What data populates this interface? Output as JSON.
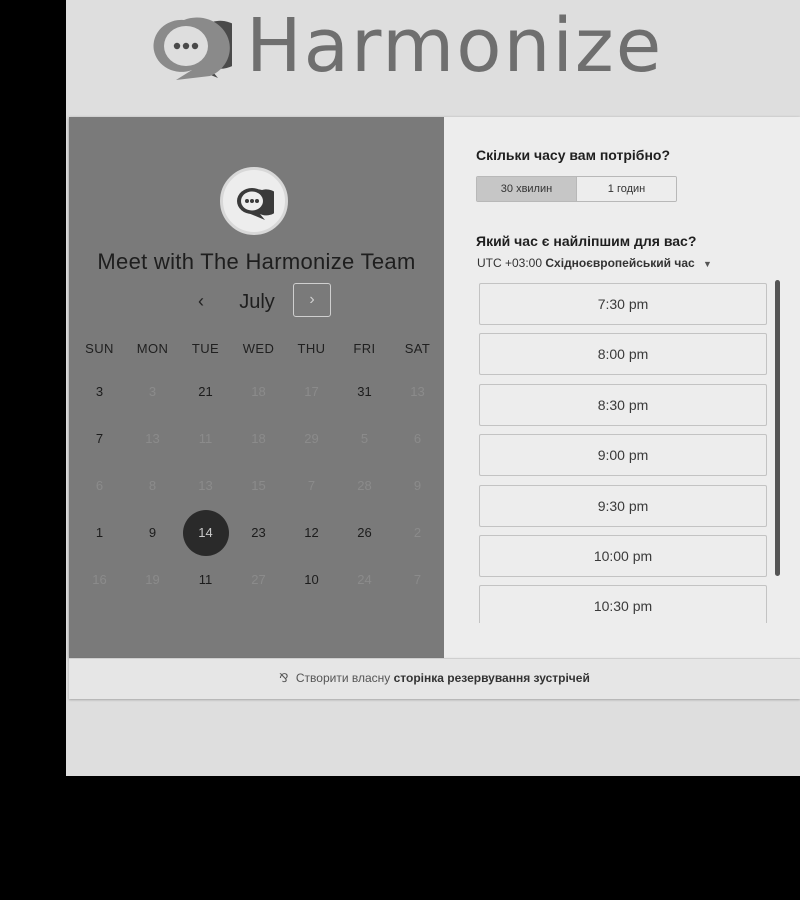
{
  "brand": {
    "name": "Harmonize",
    "logo_icon": "chat-bubbles-icon"
  },
  "calendar": {
    "title": "Meet with The Harmonize Team",
    "avatar_icon": "chat-bubbles-icon",
    "prev_label": "‹",
    "next_label": "›",
    "month": "July",
    "weekdays": [
      "SUN",
      "MON",
      "TUE",
      "WED",
      "THU",
      "FRI",
      "SAT"
    ],
    "weeks": [
      [
        {
          "d": "3",
          "on": true
        },
        {
          "d": "3",
          "on": false
        },
        {
          "d": "21",
          "on": true
        },
        {
          "d": "18",
          "on": false
        },
        {
          "d": "17",
          "on": false
        },
        {
          "d": "31",
          "on": true
        },
        {
          "d": "13",
          "on": false
        }
      ],
      [
        {
          "d": "7",
          "on": true
        },
        {
          "d": "13",
          "on": false
        },
        {
          "d": "11",
          "on": false
        },
        {
          "d": "18",
          "on": false
        },
        {
          "d": "29",
          "on": false
        },
        {
          "d": "5",
          "on": false
        },
        {
          "d": "6",
          "on": false
        }
      ],
      [
        {
          "d": "6",
          "on": false
        },
        {
          "d": "8",
          "on": false
        },
        {
          "d": "13",
          "on": false
        },
        {
          "d": "15",
          "on": false
        },
        {
          "d": "7",
          "on": false
        },
        {
          "d": "28",
          "on": false
        },
        {
          "d": "9",
          "on": false
        }
      ],
      [
        {
          "d": "1",
          "on": true
        },
        {
          "d": "9",
          "on": true
        },
        {
          "d": "14",
          "on": true,
          "selected": true
        },
        {
          "d": "23",
          "on": true
        },
        {
          "d": "12",
          "on": true
        },
        {
          "d": "26",
          "on": true
        },
        {
          "d": "2",
          "on": false
        }
      ],
      [
        {
          "d": "16",
          "on": false
        },
        {
          "d": "19",
          "on": false
        },
        {
          "d": "11",
          "on": true
        },
        {
          "d": "27",
          "on": false
        },
        {
          "d": "10",
          "on": true
        },
        {
          "d": "24",
          "on": false
        },
        {
          "d": "7",
          "on": false
        }
      ]
    ]
  },
  "duration": {
    "question": "Скільки часу вам потрібно?",
    "options": [
      "30 хвилин",
      "1 годин"
    ],
    "selected": "30 хвилин"
  },
  "time": {
    "question": "Який час є найліпшим для вас?",
    "timezone_offset": "UTC +03:00",
    "timezone_name": "Східноєвропейський час",
    "slots": [
      "7:30 pm",
      "8:00 pm",
      "8:30 pm",
      "9:00 pm",
      "9:30 pm",
      "10:00 pm",
      "10:30 pm"
    ]
  },
  "footer": {
    "prefix": "Створити власну",
    "link": "сторінка резервування зустрічей",
    "icon": "sprocket-icon"
  },
  "colors": {
    "left_panel": "#7a7a7a",
    "selected_day": "#2a2a2a",
    "selected_duration": "#c6c6c6"
  }
}
